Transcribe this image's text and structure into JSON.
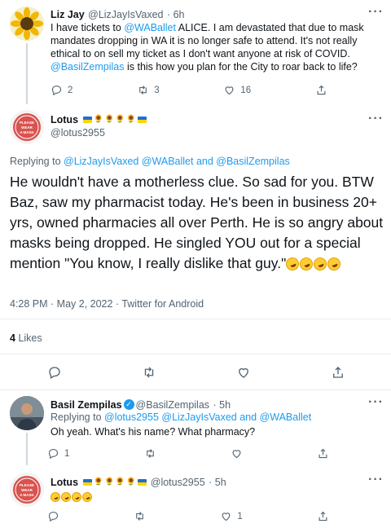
{
  "tweet1": {
    "name": "Liz Jay",
    "handle": "@LizJayIsVaxed",
    "time": "· 6h",
    "text_pre": "I have tickets to ",
    "text_mention1": "@WABallet",
    "text_mid": " ALICE. I am devastated that due to mask mandates dropping in WA it is no longer safe to attend. It's not really ethical to on sell my ticket as I don't want anyone at risk of COVID. ",
    "text_mention2": "@BasilZempilas",
    "text_post": " is this how you plan for the City to roar back to life?",
    "replies": "2",
    "retweets": "3",
    "likes": "16"
  },
  "main_tweet": {
    "name": "Lotus",
    "handle": "@lotus2955",
    "avatar_text": "PLEASE WEAR A MASK",
    "replying_label": "Replying to ",
    "replying_handles": "@LizJayIsVaxed @WABallet and @BasilZempilas",
    "text": "He wouldn't have a motherless clue. So sad for you. BTW Baz, saw my pharmacist today. He's been in business 20+ yrs, owned pharmacies all over Perth. He is so angry about masks being dropped. He singled YOU out for a special mention \"You know, I really dislike that guy.\"",
    "timestamp": "4:28 PM · May 2, 2022 · Twitter for Android",
    "likes_count": "4",
    "likes_label": "Likes"
  },
  "reply1": {
    "name": "Basil Zempilas",
    "handle": "@BasilZempilas",
    "time": "· 5h",
    "replying_label": "Replying to ",
    "replying_handles": "@lotus2955 @LizJayIsVaxed and @WABallet",
    "text": "Oh yeah. What's his name? What pharmacy?",
    "replies": "1"
  },
  "reply2": {
    "name": "Lotus",
    "handle": "@lotus2955",
    "time": "· 5h",
    "avatar_text": "PLEASE WEAR A MASK",
    "likes": "1"
  },
  "more_label": "···",
  "colors": {
    "accent": "#1d9bf0",
    "muted": "#536471",
    "text": "#0f1419",
    "divider": "#e6ecf0",
    "avatar_red": "#d9534f"
  },
  "icons": [
    "reply-icon",
    "retweet-icon",
    "like-icon",
    "share-icon",
    "more-icon",
    "verified-icon",
    "ukraine-flag-icon",
    "sunflower-icon",
    "rolling-laughing-emoji"
  ]
}
